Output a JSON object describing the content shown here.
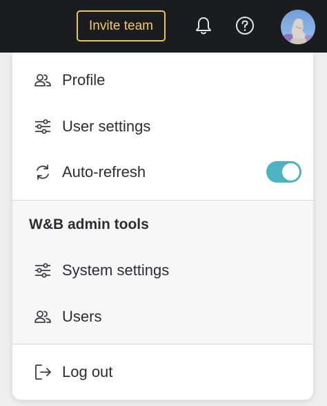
{
  "topbar": {
    "invite_label": "Invite team",
    "notifications_icon": "bell-icon",
    "help_icon": "help-circle-icon",
    "avatar_icon": "user-avatar"
  },
  "menu": {
    "items": [
      {
        "label": "Profile",
        "icon": "users-icon"
      },
      {
        "label": "User settings",
        "icon": "sliders-icon"
      },
      {
        "label": "Auto-refresh",
        "icon": "refresh-icon",
        "toggle_on": true
      }
    ],
    "admin_section_title": "W&B admin tools",
    "admin_items": [
      {
        "label": "System settings",
        "icon": "sliders-icon"
      },
      {
        "label": "Users",
        "icon": "users-icon"
      }
    ],
    "logout": {
      "label": "Log out",
      "icon": "logout-icon"
    }
  },
  "colors": {
    "topbar_bg": "#1a1c1f",
    "invite_accent": "#e8c460",
    "toggle_on": "#4db3c3",
    "text": "#2b2d31"
  }
}
